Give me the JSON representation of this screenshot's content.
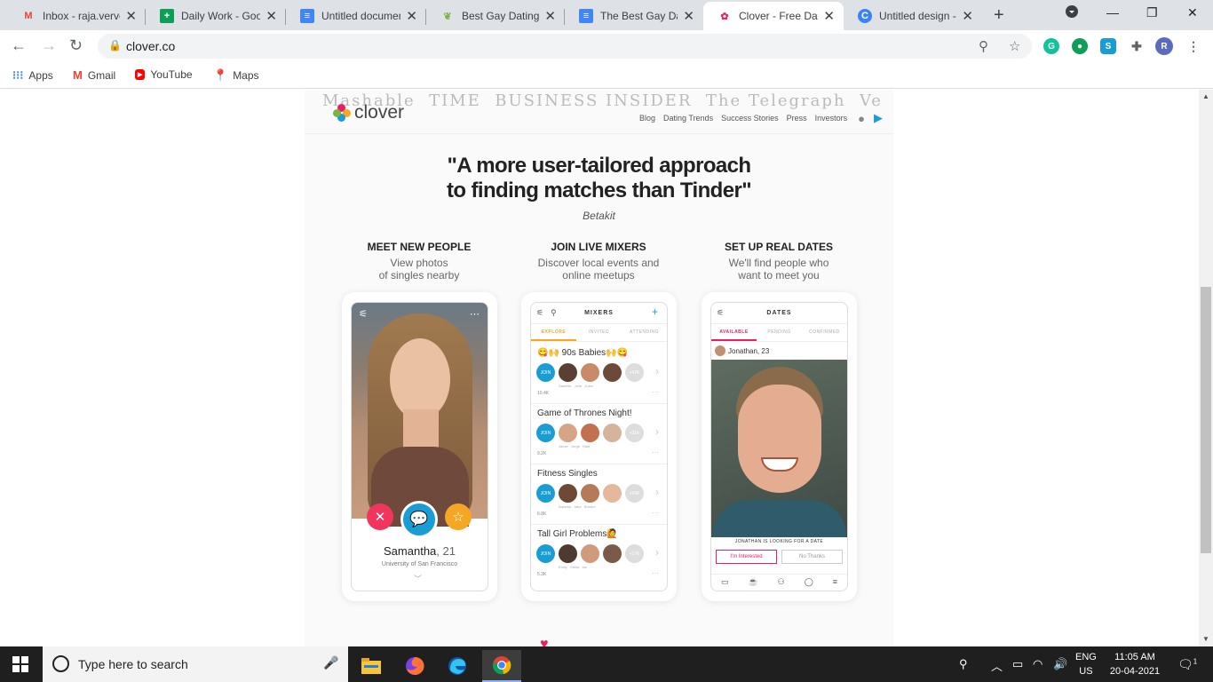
{
  "browser": {
    "tabs": [
      {
        "title": "Inbox - raja.vervel",
        "icon": "gmail-icon",
        "color": "#ea4335"
      },
      {
        "title": "Daily Work - Goo",
        "icon": "sheets-icon",
        "color": "#0f9d58"
      },
      {
        "title": "Untitled documen",
        "icon": "docs-icon",
        "color": "#4285f4"
      },
      {
        "title": "Best Gay Dating A",
        "icon": "leaf-icon",
        "color": "#7cb342"
      },
      {
        "title": "The Best Gay Dati",
        "icon": "docs-icon",
        "color": "#4285f4"
      },
      {
        "title": "Clover - Free Dati",
        "icon": "clover-icon",
        "color": "#e91e63"
      },
      {
        "title": "Untitled design -",
        "icon": "canva-icon",
        "color": "#3b82f6"
      }
    ],
    "url": "clover.co",
    "bookmarks": [
      {
        "label": "Apps",
        "icon": "apps-grid-icon"
      },
      {
        "label": "Gmail",
        "icon": "gmail-icon"
      },
      {
        "label": "YouTube",
        "icon": "youtube-icon"
      },
      {
        "label": "Maps",
        "icon": "maps-icon"
      }
    ],
    "profile_initial": "R"
  },
  "site": {
    "press_strip": "Mashable   TIME   BUSINESS INSIDER   The Telegraph   Venture   THE HUFFINGTON POST",
    "logo_text": "clover",
    "nav": [
      "Blog",
      "Dating Trends",
      "Success Stories",
      "Press",
      "Investors"
    ],
    "quote_line1": "\"A more user-tailored approach",
    "quote_line2": "to finding matches than Tinder\"",
    "quote_source": "Betakit",
    "features": [
      {
        "heading": "MEET NEW PEOPLE",
        "line1": "View photos",
        "line2": "of singles nearby"
      },
      {
        "heading": "JOIN LIVE MIXERS",
        "line1": "Discover local events and",
        "line2": "online meetups"
      },
      {
        "heading": "SET UP REAL DATES",
        "line1": "We'll find people who",
        "line2": "want to meet you"
      }
    ],
    "profile": {
      "name": "Samantha",
      "age": ", 21",
      "school": "University of San Francisco"
    },
    "mixers": {
      "title": "MIXERS",
      "tabs": [
        "EXPLORE",
        "INVITED",
        "ATTENDING"
      ],
      "join": "JOIN",
      "items": [
        {
          "name": "😋🙌 90s Babies🙌😋",
          "more": "+47K",
          "count": "10.4K",
          "names": "Danielle   Julia   Jules"
        },
        {
          "name": "Game of Thrones Night!",
          "more": "+31K",
          "count": "9.2K",
          "names": "Jamie   Jorge   Matt"
        },
        {
          "name": "Fitness Singles",
          "more": "+29K",
          "count": "6.8K",
          "names": "Isabella   Jake   Brooke"
        },
        {
          "name": "Tall Girl Problems🙋",
          "more": "+17K",
          "count": "5.3K",
          "names": "Emily   Stella   Ian"
        }
      ]
    },
    "dates": {
      "title": "DATES",
      "tabs": [
        "AVAILABLE",
        "PENDING",
        "CONFIRMED"
      ],
      "user": "Jonathan, 23",
      "looking": "JONATHAN IS LOOKING FOR A DATE",
      "interested": "I'm Interested",
      "no_thanks": "No Thanks"
    },
    "accent": "#e91e63",
    "mixer_accent": "#f5a623"
  },
  "taskbar": {
    "search_placeholder": "Type here to search",
    "lang1": "ENG",
    "lang2": "US",
    "time": "11:05 AM",
    "date": "20-04-2021",
    "notif_count": "1"
  }
}
